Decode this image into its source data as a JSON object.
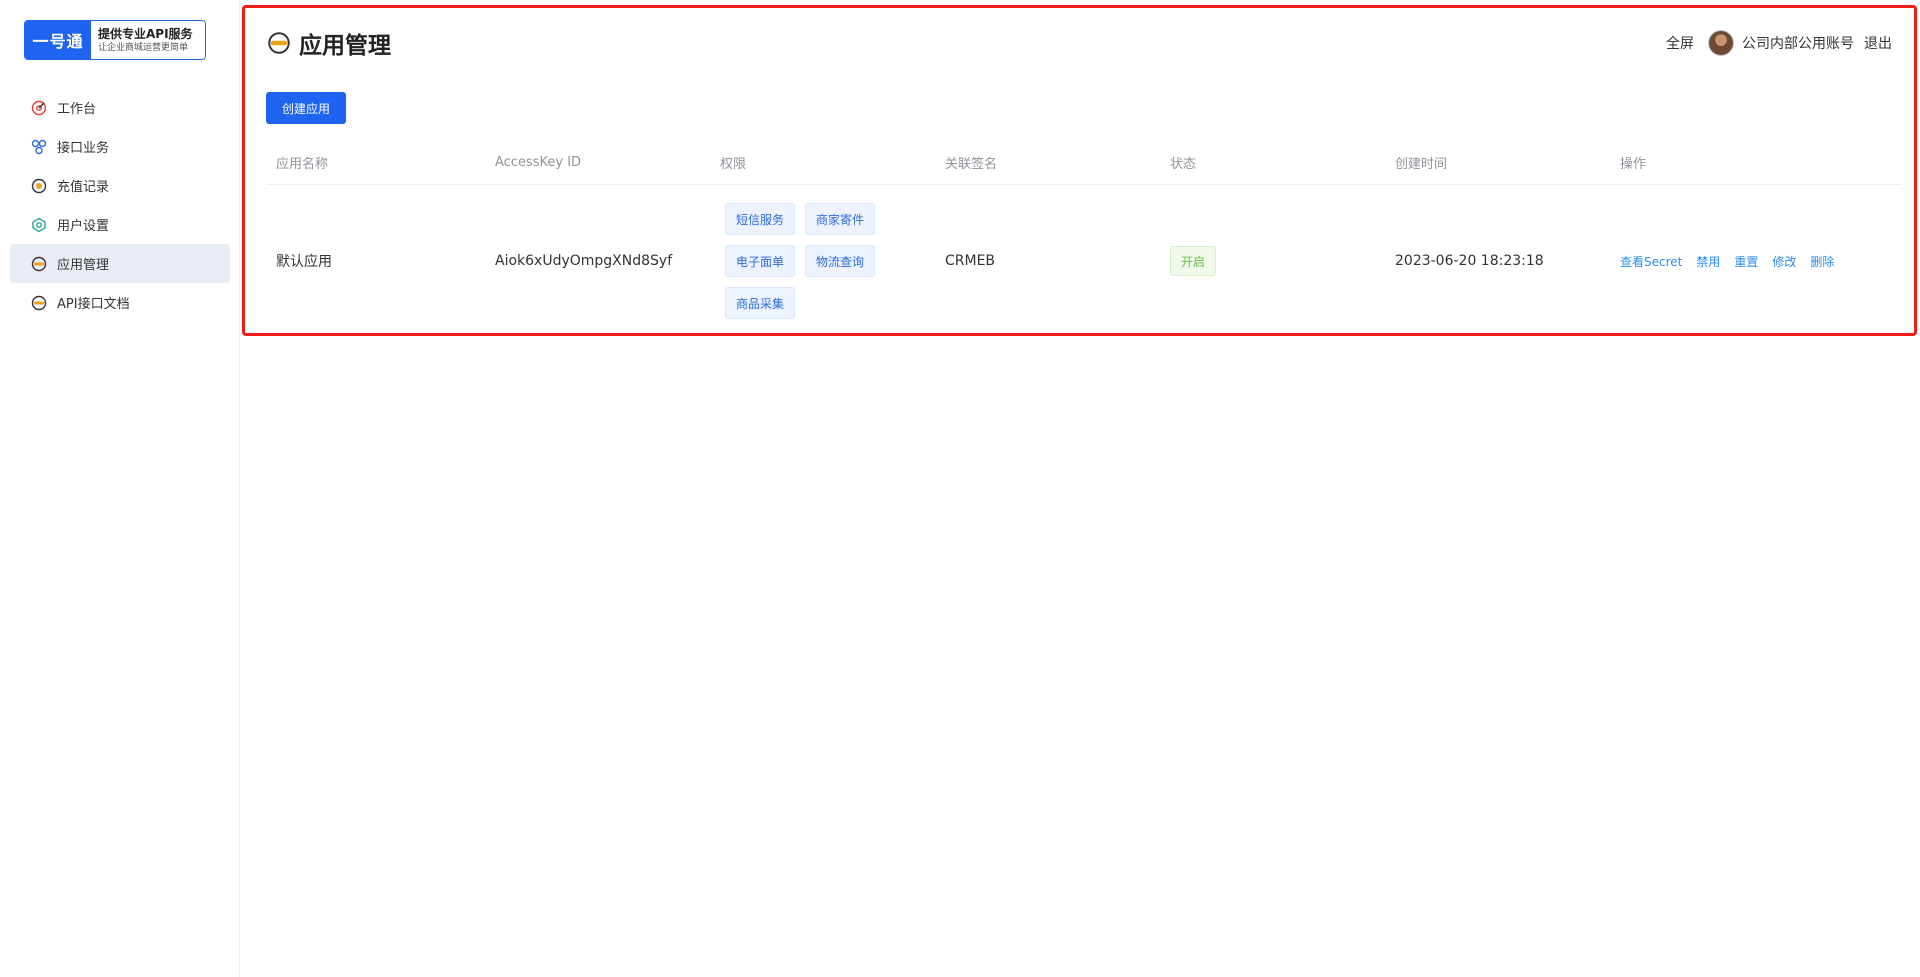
{
  "logo": {
    "mark": "一号通",
    "title": "提供专业API服务",
    "subtitle": "让企业商城运营更简单"
  },
  "sidebar": {
    "items": [
      {
        "label": "工作台",
        "icon": "dashboard-icon"
      },
      {
        "label": "接口业务",
        "icon": "api-business-icon"
      },
      {
        "label": "充值记录",
        "icon": "recharge-icon"
      },
      {
        "label": "用户设置",
        "icon": "user-settings-icon"
      },
      {
        "label": "应用管理",
        "icon": "app-management-icon",
        "active": true
      },
      {
        "label": "API接口文档",
        "icon": "api-doc-icon"
      }
    ]
  },
  "header": {
    "title": "应用管理",
    "fullscreen": "全屏",
    "account": "公司内部公用账号",
    "logout": "退出"
  },
  "toolbar": {
    "create_label": "创建应用"
  },
  "table": {
    "columns": [
      "应用名称",
      "AccessKey ID",
      "权限",
      "关联签名",
      "状态",
      "创建时间",
      "操作"
    ],
    "rows": [
      {
        "name": "默认应用",
        "access_key": "Aiok6xUdyOmpgXNd8Syf",
        "permissions": [
          "短信服务",
          "商家寄件",
          "电子面单",
          "物流查询",
          "商品采集"
        ],
        "signature": "CRMEB",
        "status": "开启",
        "created_at": "2023-06-20 18:23:18",
        "actions": [
          "查看Secret",
          "禁用",
          "重置",
          "修改",
          "删除"
        ]
      }
    ]
  },
  "colors": {
    "primary": "#1e64f0",
    "highlight_border": "#f21b1b",
    "status_green": "#67c23a",
    "link_blue": "#2d8cf0"
  }
}
